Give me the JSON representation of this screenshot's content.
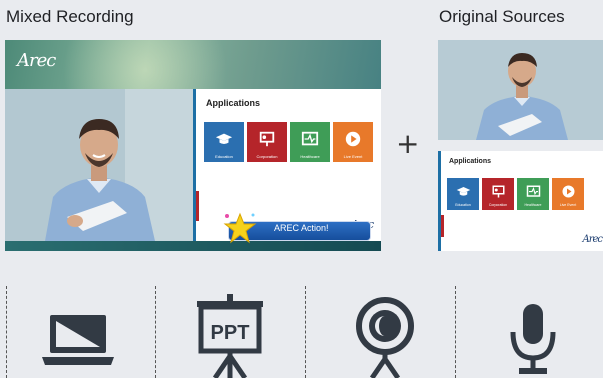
{
  "labels": {
    "mixed_recording": "Mixed Recording",
    "original_sources": "Original Sources"
  },
  "mixed": {
    "logo": "Arec",
    "slide_title": "Applications",
    "slide_brand": "Arec",
    "action_banner": "AREC Action!"
  },
  "original": {
    "slide_title": "Applications",
    "slide_brand": "Arec"
  },
  "tiles": [
    {
      "label": "Education",
      "color": "#2b6fb0",
      "icon": "graduation-cap-icon"
    },
    {
      "label": "Corporation",
      "color": "#b5252a",
      "icon": "presentation-board-icon"
    },
    {
      "label": "Healthcare",
      "color": "#3f9d57",
      "icon": "heartbeat-monitor-icon"
    },
    {
      "label": "Live Event",
      "color": "#e8792a",
      "icon": "play-circle-icon"
    }
  ],
  "plus": "+",
  "devices": [
    {
      "icon": "laptop-icon"
    },
    {
      "icon": "projector-screen-icon",
      "text": "PPT"
    },
    {
      "icon": "webcam-icon"
    },
    {
      "icon": "microphone-icon"
    }
  ],
  "colors": {
    "icon_dark": "#323a44",
    "accent_blue": "#1d6fa5",
    "background": "#e9ebef"
  }
}
